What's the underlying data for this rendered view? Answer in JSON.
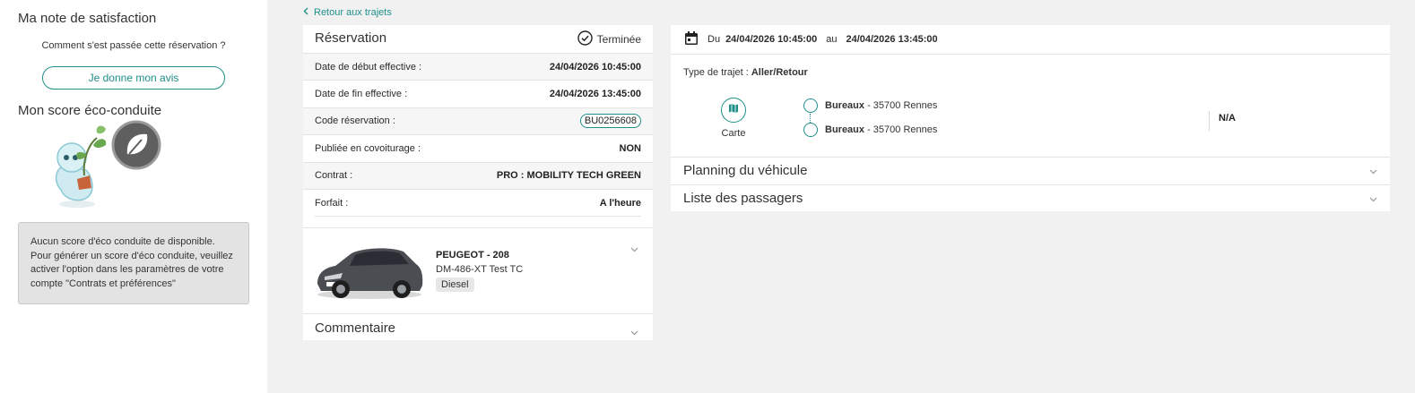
{
  "left": {
    "satisfaction_title": "Ma note de satisfaction",
    "question": "Comment s'est passée cette réservation ?",
    "avis_button": "Je donne mon avis",
    "eco_title": "Mon score éco-conduite",
    "eco_note": "Aucun score d'éco conduite de disponible. Pour générer un score d'éco conduite, veuillez activer l'option dans les paramètres de votre compte \"Contrats et préférences\""
  },
  "back_link": "Retour aux trajets",
  "reservation": {
    "title": "Réservation",
    "status": "Terminée",
    "rows": [
      {
        "label": "Date de début effective :",
        "value": "24/04/2026 10:45:00"
      },
      {
        "label": "Date de fin effective :",
        "value": "24/04/2026 13:45:00"
      },
      {
        "label": "Code réservation :",
        "value": "BU0256608"
      },
      {
        "label": "Publiée en covoiturage :",
        "value": "NON"
      },
      {
        "label": "Contrat :",
        "value": "PRO : MOBILITY TECH GREEN"
      },
      {
        "label": "Forfait :",
        "value": "A l'heure"
      }
    ],
    "vehicle": {
      "name": "PEUGEOT - 208",
      "plate": "DM-486-XT Test TC",
      "fuel": "Diesel"
    },
    "comment_label": "Commentaire"
  },
  "trip": {
    "from_prefix": "Du",
    "start": "24/04/2026 10:45:00",
    "to_prefix": "au",
    "end": "24/04/2026 13:45:00",
    "type_label": "Type de trajet :",
    "type_value": "Aller/Retour",
    "map_label": "Carte",
    "stops": [
      {
        "name": "Bureaux",
        "city": " - 35700 Rennes"
      },
      {
        "name": "Bureaux",
        "city": " - 35700 Rennes"
      }
    ],
    "extra": "N/A",
    "sections": [
      "Planning du véhicule",
      "Liste des passagers"
    ]
  },
  "colors": {
    "accent": "#1f8f8a",
    "background": "#f1f1f1"
  }
}
